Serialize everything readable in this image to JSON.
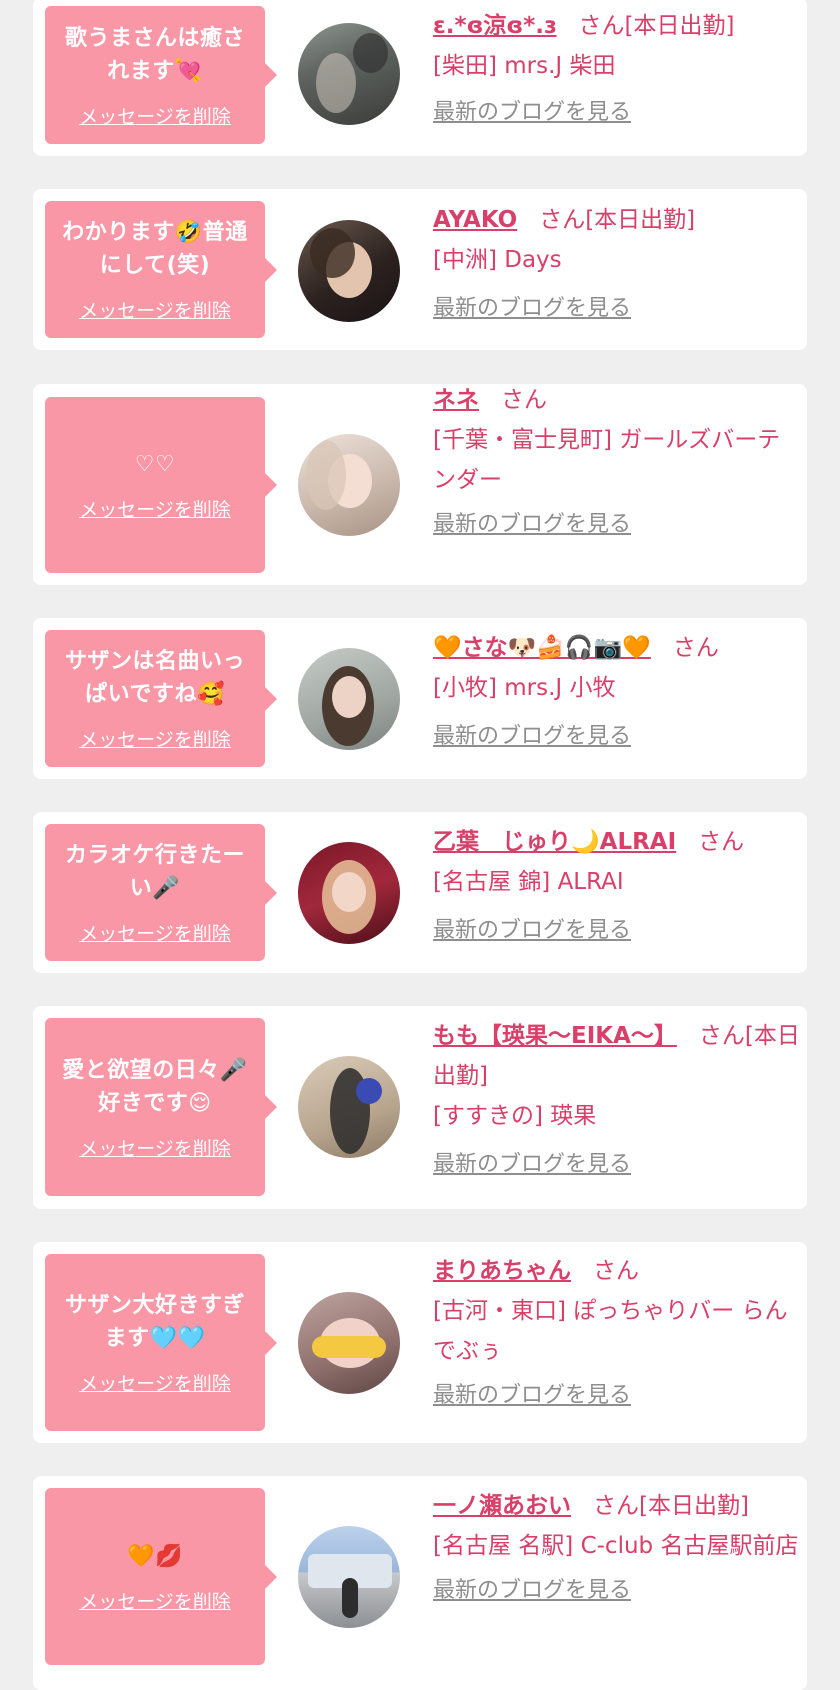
{
  "items": [
    {
      "message": "歌うまさんは癒されます💘",
      "delete_label": "メッセージを削除",
      "avatar_icon": "photo-girl",
      "name": "ɛ.*ɞ涼ɞ*.ɜ",
      "suffix": "さん[本日出勤]",
      "shop": "[柴田] mrs.J 柴田",
      "blog_label": "最新のブログを見る"
    },
    {
      "message": "わかります🤣普通にして(笑)",
      "delete_label": "メッセージを削除",
      "avatar_icon": "photo-girl",
      "name": "AYAKO",
      "suffix": "さん[本日出勤]",
      "shop": "[中洲] Days",
      "blog_label": "最新のブログを見る"
    },
    {
      "message": "♡♡",
      "delete_label": "メッセージを削除",
      "avatar_icon": "photo-girl",
      "name": "ネネ",
      "suffix": "さん",
      "shop": "[千葉・富士見町] ガールズバーテンダー",
      "blog_label": "最新のブログを見る"
    },
    {
      "message": "サザンは名曲いっぱいですね🥰",
      "delete_label": "メッセージを削除",
      "avatar_icon": "photo-girl",
      "name": "🧡さな🐶🍰🎧📷🧡",
      "suffix": "さん",
      "shop": "[小牧] mrs.J 小牧",
      "blog_label": "最新のブログを見る"
    },
    {
      "message": "カラオケ行きたーい🎤",
      "delete_label": "メッセージを削除",
      "avatar_icon": "photo-girl",
      "name": "乙葉　じゅり🌙ALRAI",
      "suffix": "さん",
      "shop": "[名古屋 錦] ALRAI",
      "blog_label": "最新のブログを見る"
    },
    {
      "message": "愛と欲望の日々🎤好きです😌",
      "delete_label": "メッセージを削除",
      "avatar_icon": "photo-girl",
      "name": "もも【瑛果〜EIKA〜】",
      "suffix": "さん[本日出勤]",
      "shop": "[すすきの] 瑛果",
      "blog_label": "最新のブログを見る"
    },
    {
      "message": "サザン大好きすぎます🩵🩵",
      "delete_label": "メッセージを削除",
      "avatar_icon": "photo-girl",
      "name": "まりあちゃん",
      "suffix": "さん",
      "shop": "[古河・東口] ぽっちゃりバー らんでぶぅ",
      "blog_label": "最新のブログを見る"
    },
    {
      "message": "🧡💋",
      "delete_label": "メッセージを削除",
      "avatar_icon": "photo-girl",
      "name": "一ノ瀬あおい",
      "suffix": "さん[本日出勤]",
      "shop": "[名古屋 名駅] C-club 名古屋駅前店",
      "blog_label": "最新のブログを見る"
    }
  ]
}
